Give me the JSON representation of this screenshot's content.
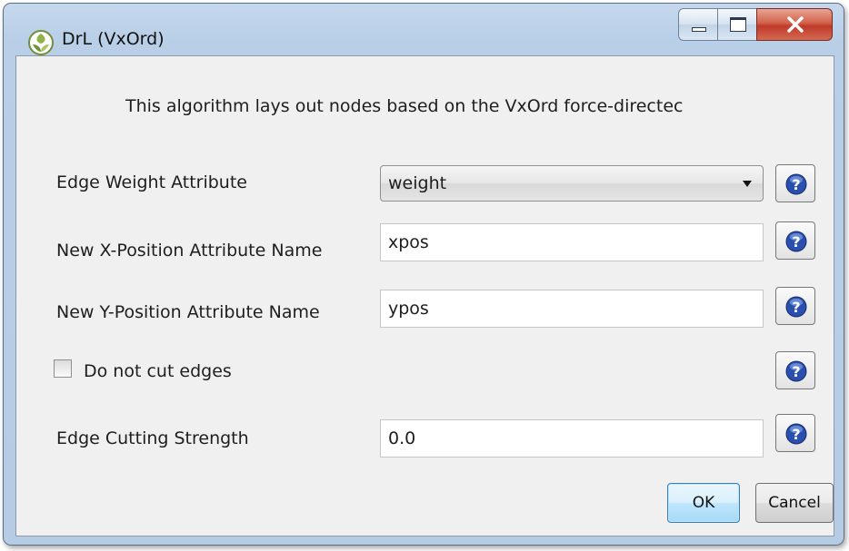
{
  "window": {
    "title": "DrL (VxOrd)",
    "title_icon": "cytoscape-icon",
    "controls": [
      "minimize-icon",
      "maximize-icon",
      "close-icon"
    ]
  },
  "dialog": {
    "description": "This algorithm lays out nodes based on the VxOrd force-directec",
    "edge_weight": {
      "label": "Edge Weight Attribute",
      "value": "weight"
    },
    "x_position": {
      "label": "New X-Position Attribute Name",
      "value": "xpos"
    },
    "y_position": {
      "label": "New Y-Position Attribute Name",
      "value": "ypos"
    },
    "no_cut": {
      "label": "Do not cut edges",
      "checked": false
    },
    "cut_strength": {
      "label": "Edge Cutting Strength",
      "value": "0.0"
    },
    "help_icon": "help-question-icon",
    "ok_label": "OK",
    "cancel_label": "Cancel"
  },
  "colors": {
    "frame": "#b9cfe7",
    "client": "#f0f0f0",
    "close_button": "#c0392b",
    "help_icon": "#2a4fae",
    "ok_border": "#3c7fb1"
  }
}
